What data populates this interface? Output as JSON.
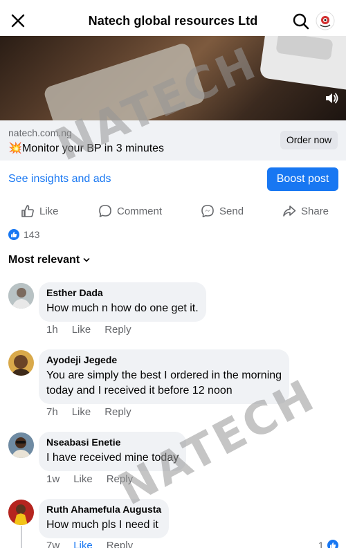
{
  "header": {
    "title": "Natech global resources Ltd"
  },
  "ad": {
    "domain": "natech.com.ng",
    "headline": "💥Monitor your BP in 3 minutes",
    "cta_label": "Order now"
  },
  "post_tools": {
    "insights_label": "See insights and ads",
    "boost_label": "Boost post"
  },
  "actions": {
    "like": "Like",
    "comment": "Comment",
    "send": "Send",
    "share": "Share"
  },
  "reactions": {
    "count": "143"
  },
  "comments_sort": {
    "label": "Most relevant"
  },
  "comments": [
    {
      "name": "Esther Dada",
      "text": "How much n how do one get it.",
      "time": "1h",
      "like": "Like",
      "reply": "Reply"
    },
    {
      "name": "Ayodeji Jegede",
      "text_line1": "You are simply the best I ordered in the morning",
      "text_line2": "today and I received it before 12 noon",
      "time": "7h",
      "like": "Like",
      "reply": "Reply"
    },
    {
      "name": "Nseabasi Enetie",
      "text": "I have received mine today",
      "time": "1w",
      "like": "Like",
      "reply": "Reply"
    },
    {
      "name": "Ruth Ahamefula Augusta",
      "text": "How much pls I need it",
      "time": "7w",
      "like": "Like",
      "reply": "Reply",
      "reaction_count": "1"
    }
  ],
  "watermark": {
    "text": "NATECH"
  },
  "colors": {
    "accent": "#1877f2",
    "secondary_text": "#65676b",
    "bubble": "#f0f2f5"
  }
}
